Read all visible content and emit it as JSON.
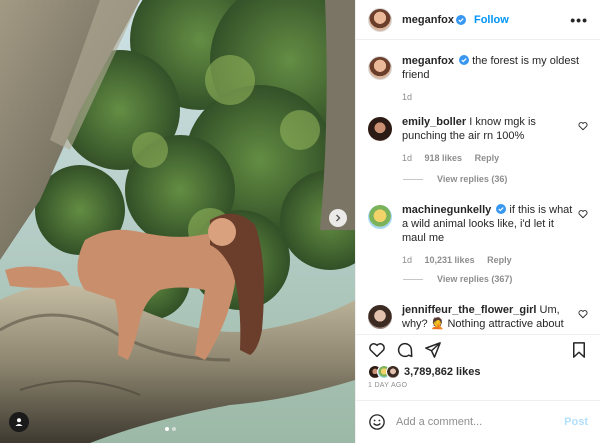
{
  "header": {
    "username": "meganfox",
    "follow_label": "Follow",
    "more_label": "•••"
  },
  "caption": {
    "username": "meganfox",
    "text": "the forest is my oldest friend",
    "time": "1d"
  },
  "comments": [
    {
      "username": "emily_boller",
      "text": "I know mgk is punching the air rn 100%",
      "time": "1d",
      "likes": "918 likes",
      "reply_label": "Reply",
      "view_replies": "View replies (36)"
    },
    {
      "username": "machinegunkelly",
      "text": "if this is what a wild animal looks like, i'd let it maul me",
      "time": "1d",
      "likes": "10,231 likes",
      "reply_label": "Reply",
      "view_replies": "View replies (367)"
    },
    {
      "username": "jenniffeur_the_flower_girl",
      "text": "Um, why? 🤦 Nothing attractive about"
    }
  ],
  "engagement": {
    "likes": "3,789,862 likes",
    "date": "1 DAY AGO"
  },
  "composer": {
    "placeholder": "Add a comment...",
    "post_label": "Post"
  },
  "icons": {
    "like": "heart-icon",
    "comment": "comment-icon",
    "share": "share-icon",
    "save": "bookmark-icon",
    "emoji": "emoji-icon",
    "tag": "user-tag-icon",
    "next": "chevron-right-icon"
  },
  "colors": {
    "accent": "#0095f6",
    "verified": "#3897f0",
    "muted": "#8e8e8e",
    "post_disabled": "#b2dffc"
  }
}
